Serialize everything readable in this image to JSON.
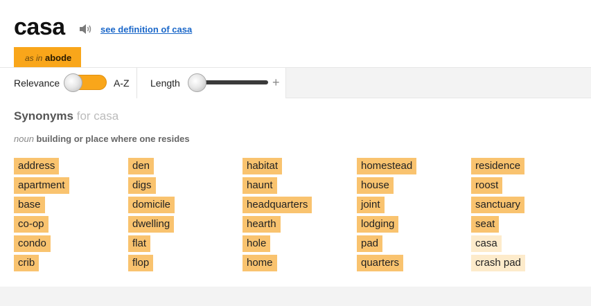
{
  "entry": {
    "headword": "casa",
    "see_definition_label": "see definition of casa"
  },
  "sense_tab": {
    "as_in": "as in",
    "word": "abode"
  },
  "toolbar": {
    "relevance_label": "Relevance",
    "az_label": "A-Z",
    "length_label": "Length",
    "plus_symbol": "+"
  },
  "synonyms": {
    "title": "Synonyms",
    "for_text": "for casa",
    "pos": "noun",
    "definition": "building or place where one resides",
    "columns": [
      [
        "address",
        "apartment",
        "base",
        "co-op",
        "condo",
        "crib"
      ],
      [
        "den",
        "digs",
        "domicile",
        "dwelling",
        "flat",
        "flop"
      ],
      [
        "habitat",
        "haunt",
        "headquarters",
        "hearth",
        "hole",
        "home"
      ],
      [
        "homestead",
        "house",
        "joint",
        "lodging",
        "pad",
        "quarters"
      ],
      [
        "residence",
        "roost",
        "sanctuary",
        "seat",
        "casa",
        "crash pad"
      ]
    ],
    "light_words": [
      "casa",
      "crash pad"
    ]
  },
  "colors": {
    "chip": "#f9c36f",
    "chip_light": "#fdebcb",
    "accent": "#f9a61a",
    "link": "#1a67c9"
  }
}
